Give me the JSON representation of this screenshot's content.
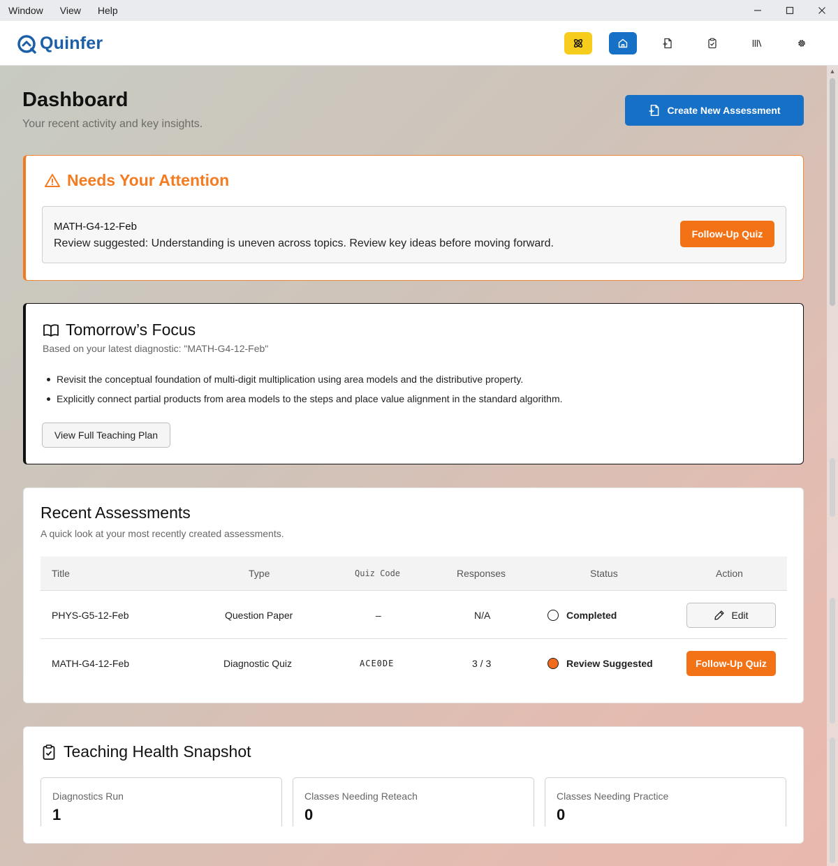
{
  "menu": [
    "Window",
    "View",
    "Help"
  ],
  "window_controls": [
    "minimize-icon",
    "maximize-icon",
    "close-icon"
  ],
  "brand": {
    "name": "Quinfer",
    "color": "#1a5fa8"
  },
  "nav": [
    {
      "icon": "atom-icon",
      "active": false
    },
    {
      "icon": "home-icon",
      "active": true
    },
    {
      "icon": "new-document-icon",
      "active": false
    },
    {
      "icon": "clipboard-check-icon",
      "active": false
    },
    {
      "icon": "library-icon",
      "active": false
    },
    {
      "icon": "gear-icon",
      "active": false
    }
  ],
  "page": {
    "title": "Dashboard",
    "subtitle": "Your recent activity and key insights.",
    "create_button": "Create New Assessment"
  },
  "attention": {
    "title": "Needs Your Attention",
    "item_code": "MATH-G4-12-Feb",
    "item_text": "Review suggested: Understanding is uneven across topics. Review key ideas before moving forward.",
    "action": "Follow-Up Quiz"
  },
  "focus": {
    "title": "Tomorrow’s Focus",
    "subtitle": "Based on your latest diagnostic: \"MATH-G4-12-Feb\"",
    "bullets": [
      "Revisit the conceptual foundation of multi-digit multiplication using area models and the distributive property.",
      "Explicitly connect partial products from area models to the steps and place value alignment in the standard algorithm."
    ],
    "button": "View Full Teaching Plan"
  },
  "recent": {
    "title": "Recent Assessments",
    "subtitle": "A quick look at your most recently created assessments.",
    "columns": [
      "Title",
      "Type",
      "Quiz Code",
      "Responses",
      "Status",
      "Action"
    ],
    "rows": [
      {
        "title": "PHYS-G5-12-Feb",
        "type": "Question Paper",
        "code": "–",
        "responses": "N/A",
        "status": "Completed",
        "action": "Edit"
      },
      {
        "title": "MATH-G4-12-Feb",
        "type": "Diagnostic Quiz",
        "code": "ACE0DE",
        "responses": "3 / 3",
        "status": "Review Suggested",
        "action": "Follow-Up Quiz"
      }
    ]
  },
  "health": {
    "title": "Teaching Health Snapshot",
    "stats": [
      {
        "label": "Diagnostics Run",
        "value": "1"
      },
      {
        "label": "Classes Needing Reteach",
        "value": "0"
      },
      {
        "label": "Classes Needing Practice",
        "value": "0"
      }
    ]
  },
  "colors": {
    "primary": "#1671c6",
    "accent_orange": "#f47216",
    "ai_yellow": "#f7cd1d"
  }
}
